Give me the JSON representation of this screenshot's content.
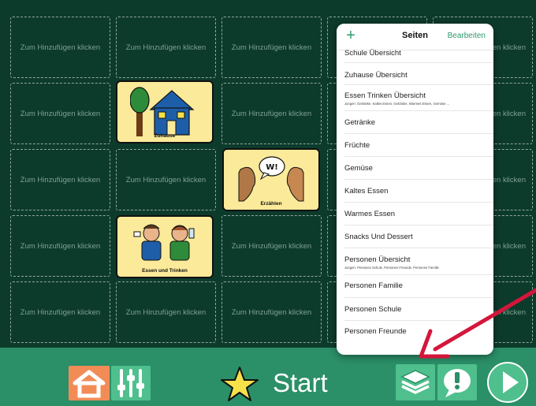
{
  "board": {
    "placeholder": "Zum Hinzufügen klicken",
    "cards": {
      "home": {
        "label": "Zuhause"
      },
      "talk": {
        "label": "Erzählen"
      },
      "eat": {
        "label": "Essen und Trinken"
      }
    }
  },
  "popover": {
    "title": "Seiten",
    "edit_label": "Bearbeiten",
    "add_icon": "+",
    "items": [
      {
        "label": "Schule Übersicht",
        "sub": ""
      },
      {
        "label": "Zuhause Übersicht",
        "sub": ""
      },
      {
        "label": "Essen Trinken Übersicht",
        "sub": "Jungen: Getränke, Kaltes Essen, Getränke, Warmes Essen, Gemüse ..."
      },
      {
        "label": "Getränke",
        "sub": ""
      },
      {
        "label": "Früchte",
        "sub": ""
      },
      {
        "label": "Gemüse",
        "sub": ""
      },
      {
        "label": "Kaltes Essen",
        "sub": ""
      },
      {
        "label": "Warmes Essen",
        "sub": ""
      },
      {
        "label": "Snacks Und Dessert",
        "sub": ""
      },
      {
        "label": "Personen Übersicht",
        "sub": "Jungen: Personen Schule, Personen Freunde, Personen Familie"
      },
      {
        "label": "Personen Familie",
        "sub": ""
      },
      {
        "label": "Personen Schule",
        "sub": ""
      },
      {
        "label": "Personen Freunde",
        "sub": ""
      }
    ]
  },
  "toolbar": {
    "start_label": "Start",
    "icons": [
      "home-icon",
      "sliders-icon",
      "star-icon",
      "pages-stack-icon",
      "speech-alert-icon",
      "play-icon"
    ]
  },
  "colors": {
    "board_bg": "#0d3b2b",
    "toolbar_bg": "#2b8f68",
    "accent_green": "#2f9a6b",
    "card_bg": "#fbea9a",
    "home_orange": "#f28c57",
    "star_yellow": "#f7e14b",
    "annotation_arrow": "#d4163c"
  }
}
